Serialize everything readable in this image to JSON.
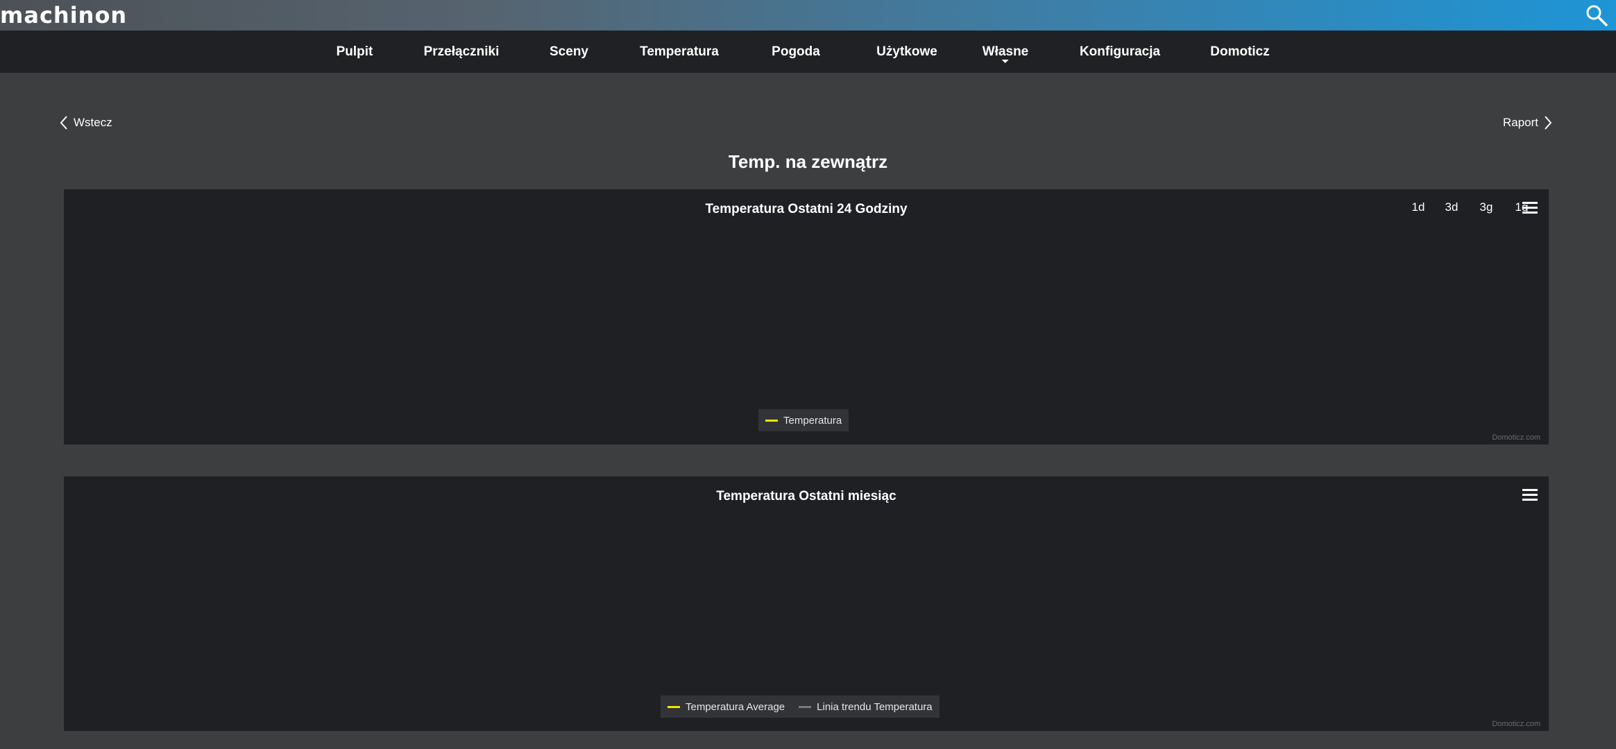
{
  "header": {
    "logo_text": "machinon",
    "search_icon": "search-icon"
  },
  "nav": {
    "items": [
      {
        "label": "Pulpit"
      },
      {
        "label": "Przełączniki"
      },
      {
        "label": "Sceny"
      },
      {
        "label": "Temperatura"
      },
      {
        "label": "Pogoda"
      },
      {
        "label": "Użytkowe"
      },
      {
        "label": "Własne"
      },
      {
        "label": "Konfiguracja"
      },
      {
        "label": "Domoticz"
      }
    ]
  },
  "page": {
    "back_label": "Wstecz",
    "report_label": "Raport",
    "title": "Temp. na zewnątrz"
  },
  "charts": [
    {
      "title": "Temperatura Ostatni 24 Godziny",
      "range_buttons": [
        "3d",
        "1d",
        "3g",
        "1g"
      ],
      "legend": [
        {
          "label": "Temperatura",
          "color": "#f2e600"
        }
      ],
      "credits": "Domoticz.com"
    },
    {
      "title": "Temperatura Ostatni miesiąc",
      "legend": [
        {
          "label": "Temperatura Average",
          "color": "#f2e600"
        },
        {
          "label": "Linia trendu Temperatura",
          "color": "#7a7b80"
        }
      ],
      "credits": "Domoticz.com"
    }
  ],
  "colors": {
    "accent": "#1e95d6",
    "navbar_bg": "#202124",
    "page_bg": "#3d3e40",
    "panel_bg": "#1f2023"
  }
}
